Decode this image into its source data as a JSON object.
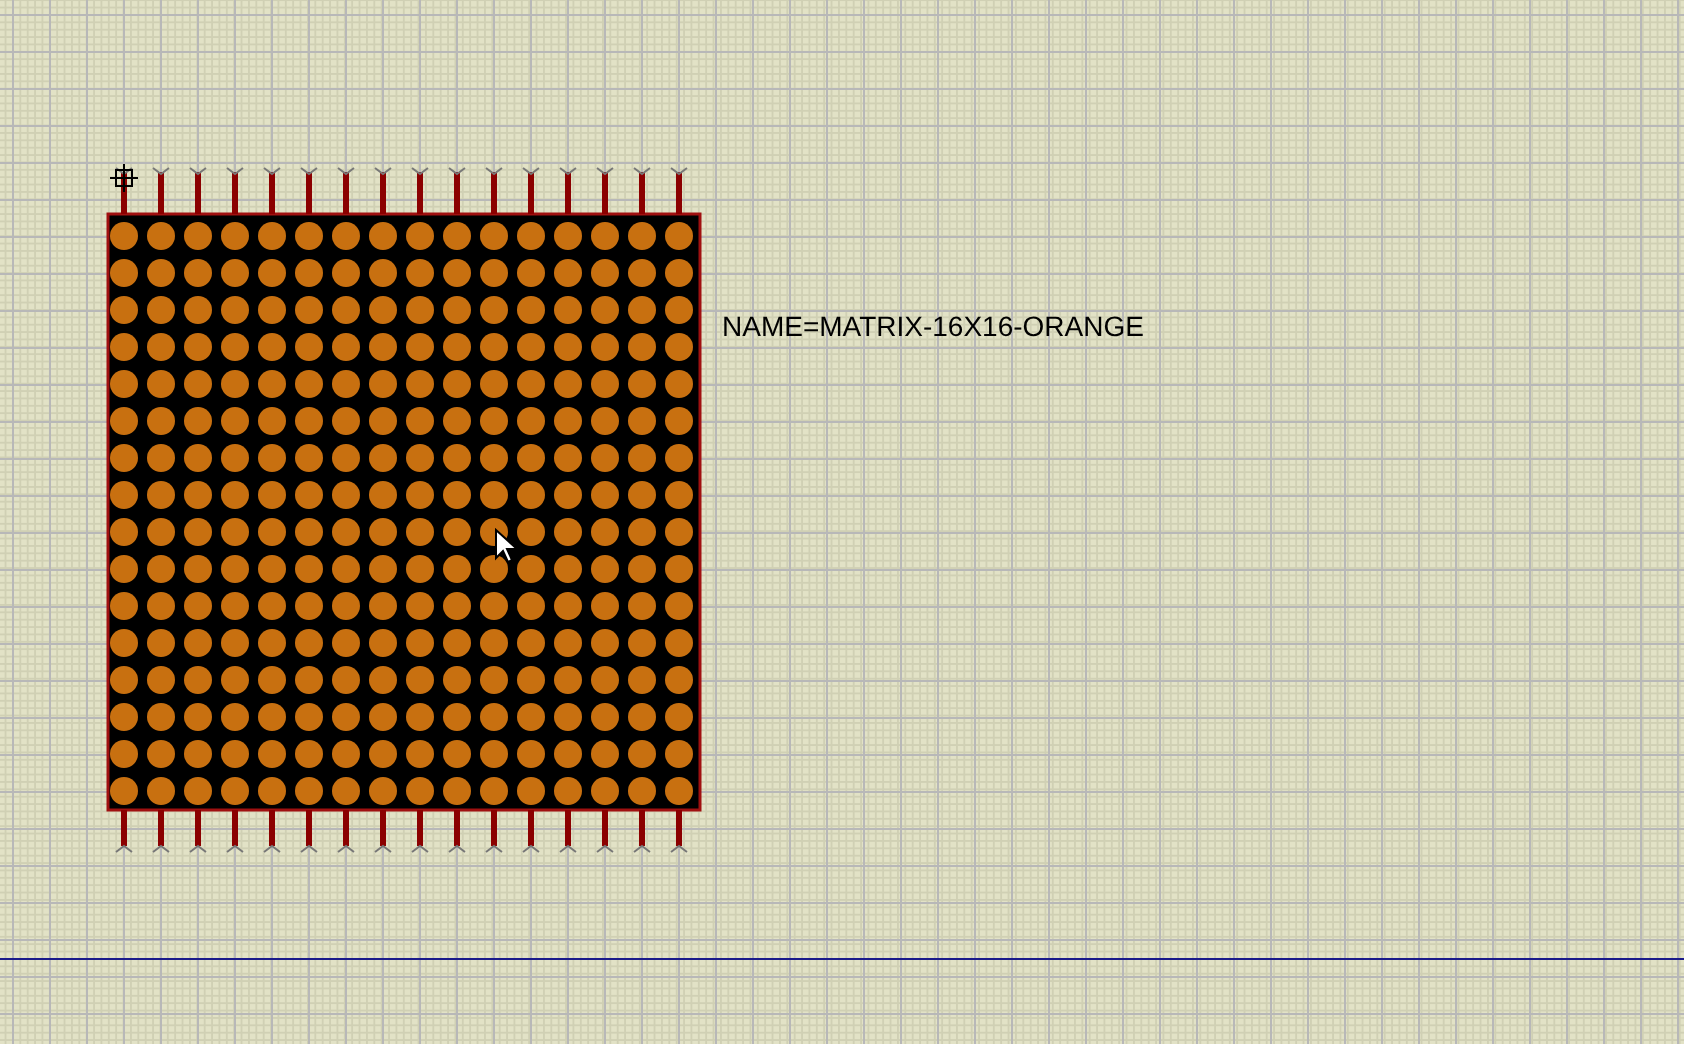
{
  "component": {
    "label": "NAME=MATRIX-16X16-ORANGE"
  }
}
